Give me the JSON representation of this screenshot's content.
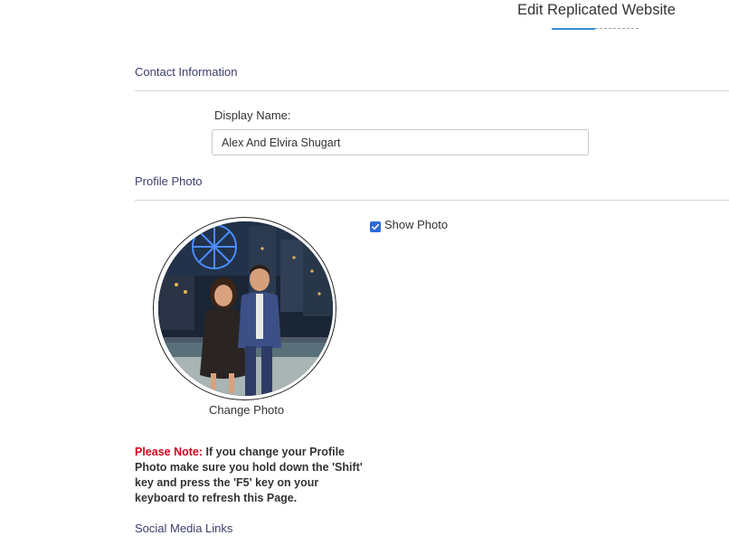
{
  "header": {
    "title": "Edit Replicated Website",
    "progress_fraction": 0.5
  },
  "contact_section": {
    "title": "Contact Information",
    "display_name_label": "Display Name:",
    "display_name_value": "Alex And Elvira Shugart"
  },
  "photo_section": {
    "title": "Profile Photo",
    "change_photo_label": "Change Photo",
    "show_photo_label": "Show Photo",
    "show_photo_checked": true
  },
  "note": {
    "label": "Please Note:",
    "text": " If you change your Profile Photo make sure you hold down the 'Shift' key and press the 'F5' key on your keyboard to refresh this Page."
  },
  "social_section": {
    "title": "Social Media Links"
  },
  "colors": {
    "accent": "#3a8fd3",
    "checkbox": "#2b6ad6",
    "note_label": "#d0021b",
    "section_title": "#3b3f6b"
  }
}
